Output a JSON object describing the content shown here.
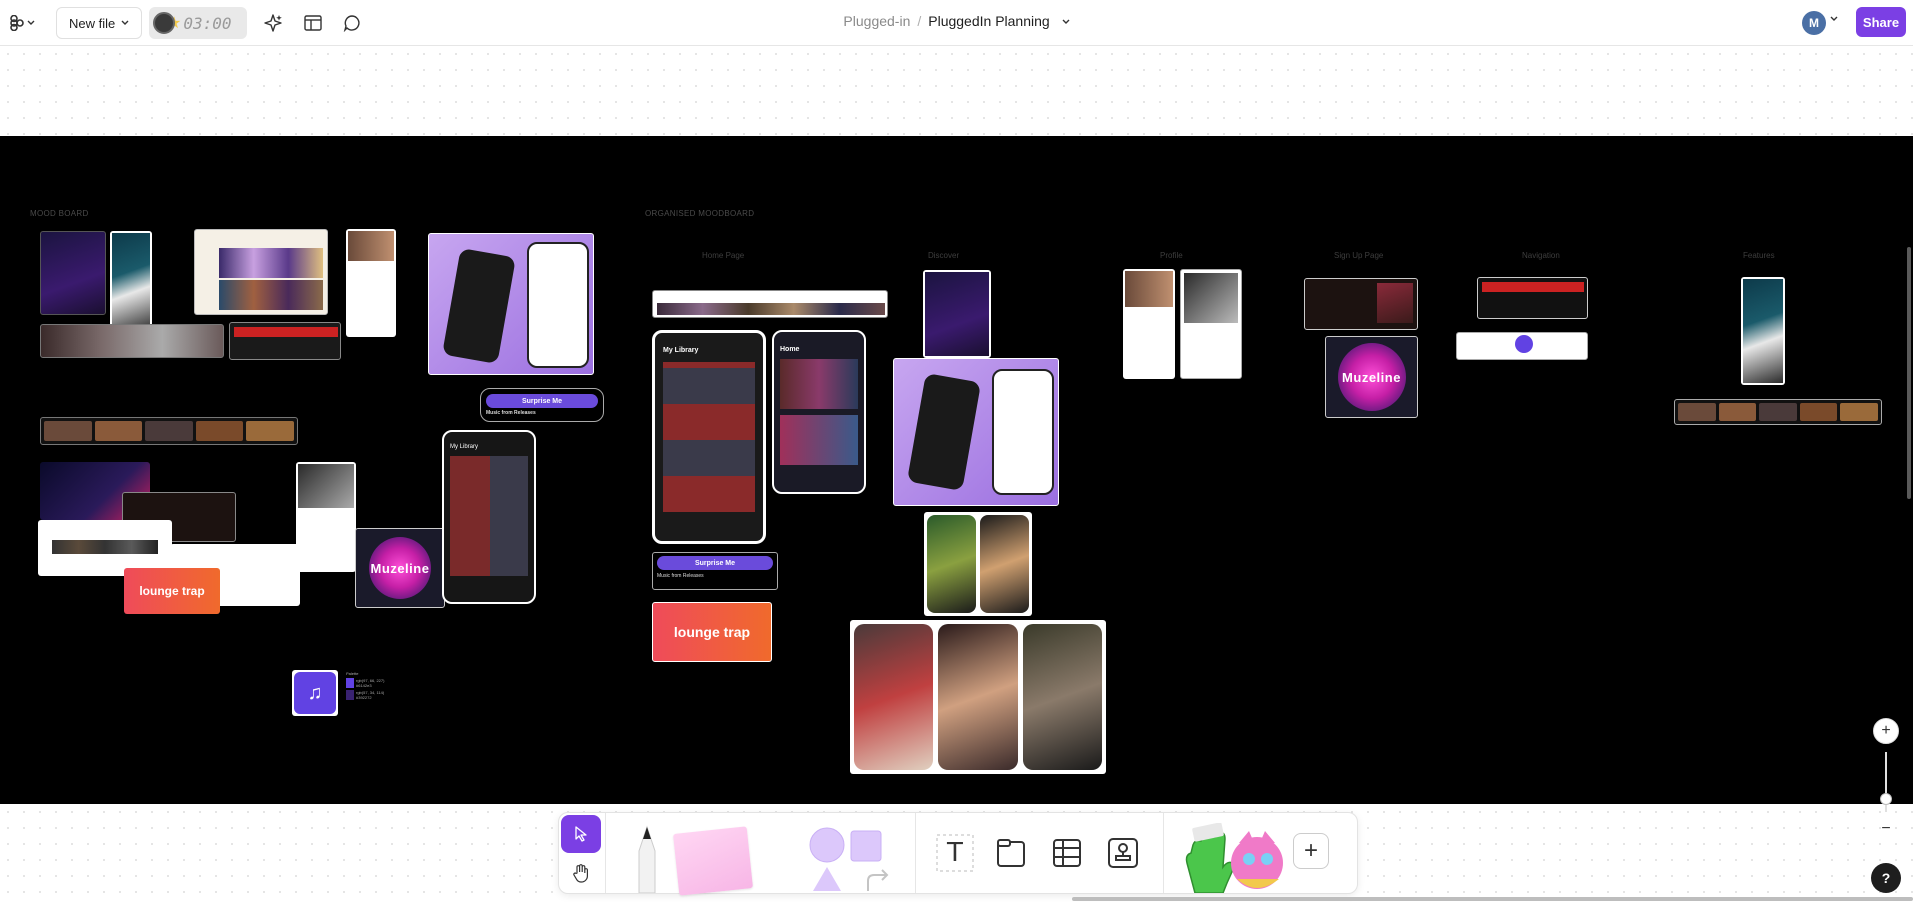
{
  "topbar": {
    "new_file_label": "New file",
    "timer": "03:00",
    "team_name": "Plugged-in",
    "separator": "/",
    "file_name": "PluggedIn Planning",
    "avatar_initial": "M",
    "share_label": "Share"
  },
  "canvas": {
    "moodboard_title": "MOOD BOARD",
    "organised_title": "ORGANISED MOODBOARD",
    "columns": [
      "Home Page",
      "Discover",
      "Profile",
      "Sign Up Page",
      "Navigation",
      "Features"
    ],
    "lounge_trap": "lounge trap",
    "surprise_me": "Surprise Me",
    "music_from_releases": "Music from Releases",
    "muzeline": "Muzeline",
    "my_library": "My Library",
    "home": "Home",
    "palette_title": "Palette",
    "palette_values": [
      "rgb(97, 66, 227)",
      "#6142e3",
      "rgb(57, 34, 114)",
      "#392272"
    ],
    "colors": {
      "accent": "#7b3fe4",
      "palette_purple": "#6142e3",
      "palette_dark": "#392272",
      "orange_gradient_start": "#ef4b5a",
      "orange_gradient_end": "#f06a2c"
    }
  },
  "toolbar": {
    "tools": [
      "move-tool",
      "hand-tool",
      "marker-tool",
      "sticky-note-tool",
      "shapes-tool",
      "connector-tool",
      "text-tool",
      "section-tool",
      "table-tool",
      "stamp-tool",
      "widgets-tool",
      "more-tool"
    ],
    "text_tool_glyph": "T",
    "more_glyph": "+"
  },
  "zoom": {
    "plus": "+",
    "minus": "−"
  },
  "help_label": "?"
}
